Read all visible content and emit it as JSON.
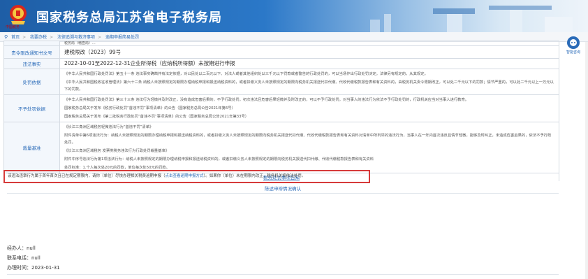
{
  "header": {
    "site_title": "国家税务总局江苏省电子税务局",
    "emblem_caption": "中国税务"
  },
  "breadcrumb": {
    "items": [
      "首页",
      "我要办税",
      "法律追溯与救济事项",
      "逾期申报简易处罚"
    ]
  },
  "sidebar_tools": {
    "label": "智能咨询"
  },
  "table": {
    "row0": {
      "label": "",
      "value": "税务局（稽查局）..."
    },
    "row1": {
      "label": "责令限改通知书文号",
      "value": "建税限改（2023）99号"
    },
    "row2": {
      "label": "违法事实",
      "value": "2022-10-01至2022-12-31企业所得税（应纳税所得额）未按期进行申报"
    },
    "row3": {
      "label": "处罚依据",
      "lines": [
        "《中华人民共和国行政处罚法》第五十一条  违法事实确凿并有法定依据，对公民处以二百元以下、对法人或者其他组织处以三千元以下罚款或者警告的行政处罚的，可以当场作出行政处罚决定。法律另有规定的，从其规定。",
        "《中华人民共和国税收征收管理法》第六十二条  纳税人未按照规定的期限办理纳税申报和报送纳税资料的，或者扣缴义务人未按照规定的期限向税务机关报送代扣代缴、代收代缴税款报告表和有关资料的，由税务机关责令限期改正，可以处二千元以下的罚款；情节严重的，可以处二千元以上一万元以下的罚款。"
      ]
    },
    "row4": {
      "label": "不予处罚依据",
      "lines": [
        "《中华人民共和国行政处罚法》第三十三条  违法行为轻微并及时改正，没有造成危害后果的，不予行政处罚。初次违法且危害后果轻微并及时改正的，可以不予行政处罚。对当事人的违法行为依法不予行政处罚的，行政机关应当对当事人进行教育。",
        "国家税务总局关于发布《税务行政处罚“首违不罚”事项清单》的公告（国家税务总局公告2021年第6号）",
        "国家税务总局关于发布《第二批税务行政处罚“首违不罚”事项清单》的公告（国家税务总局公告2021年第33号）"
      ]
    },
    "row5": {
      "label": "裁量基准",
      "lines": [
        "《长江三角洲区域税务轻微违法行为“首违不罚”清单》",
        "附件清单中第6项违法行为：纳税人未按照规定的期限办理纳税申报和报送纳税资料的，或者扣缴义务人未按照规定的期限向税务机关报送代扣代缴、代收代缴税款报告表和有关资料对清单中所列举的违法行为，当事人在一年内首次违反且情节轻微，能够及时纠正，未造成危害后果的，依法不予行政处罚。",
        "《长江三角洲区域税务 发票类税务违法行为行政处罚裁量基准》",
        "附件中序号违法行为第1项违法行为：纳税人未按照规定的期限办理纳税申报和报送纳税资料的，或者扣缴义务人未按照规定的期限向税务机关报送代扣代缴、代收代缴税款报告表和有关资料",
        "处罚标准：1.个人每次处20元的罚款，单位每次处50元的罚款。"
      ]
    },
    "notice_link": "税务处罚事项告知"
  },
  "notice": {
    "prefix": "该违法违章行为属于首年首次且已在规定期限内，请你（单位）尽快办理相关税费逾期申报（",
    "link": "点击查看逾期申报方式",
    "suffix": "）。如果你（单位）未在期限内改正，税务机关将依法处罚。"
  },
  "confirm_link": "陈述申辩情况确认",
  "meta": {
    "handler": "经办人：null",
    "phone": "联系电话：null",
    "time": "办理时间：2023-01-31"
  }
}
